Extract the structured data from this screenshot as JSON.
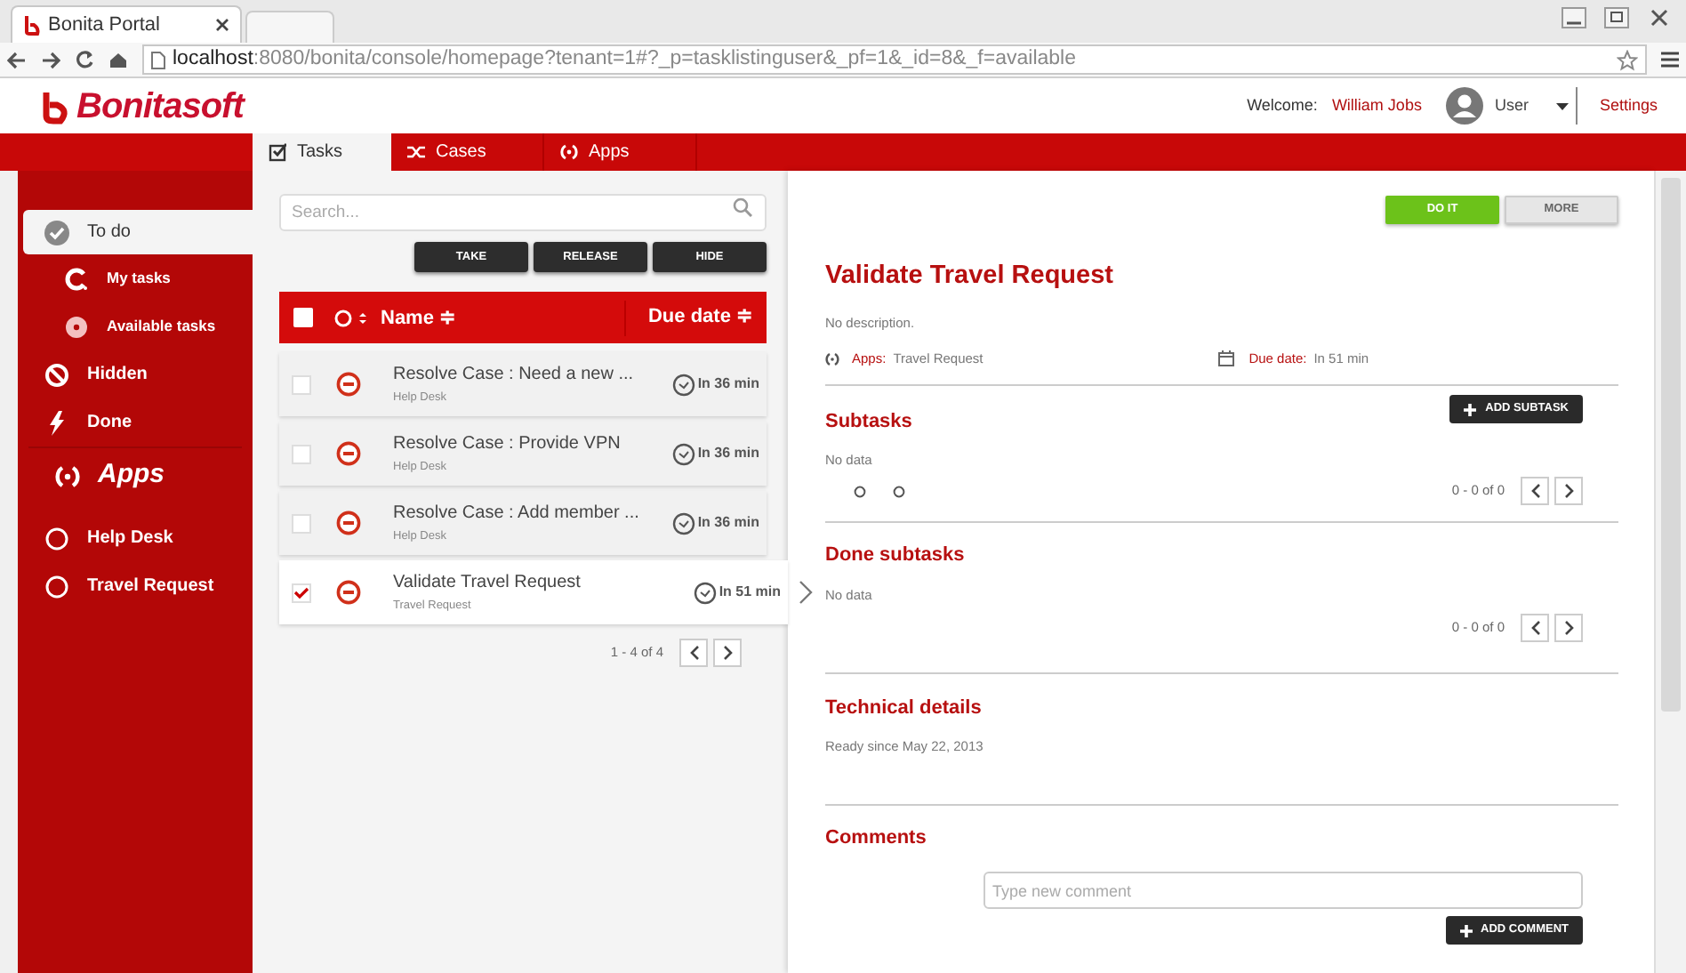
{
  "browser": {
    "tab_title": "Bonita Portal",
    "url_host": "localhost",
    "url_path": ":8080/bonita/console/homepage?tenant=1#?_p=tasklistinguser&_pf=1&_id=8&_f=available"
  },
  "header": {
    "logo": "Bonitasoft",
    "welcome": "Welcome:",
    "user_name": "William Jobs",
    "user_menu": "User",
    "settings": "Settings"
  },
  "nav_tabs": [
    {
      "label": "Tasks",
      "kind": "tasks",
      "selected": true
    },
    {
      "label": "Cases",
      "kind": "cases",
      "selected": false
    },
    {
      "label": "Apps",
      "kind": "apps",
      "selected": false
    }
  ],
  "sidebar": {
    "items": [
      {
        "label": "To do",
        "kind": "todo",
        "selected": true
      },
      {
        "label": "My tasks",
        "kind": "mytasks",
        "selected": false
      },
      {
        "label": "Available tasks",
        "kind": "available",
        "selected": false
      },
      {
        "label": "Hidden",
        "kind": "hidden",
        "selected": false
      },
      {
        "label": "Done",
        "kind": "done",
        "selected": false
      },
      {
        "label": "Apps",
        "kind": "section",
        "selected": false
      },
      {
        "label": "Help Desk",
        "kind": "app",
        "selected": false
      },
      {
        "label": "Travel Request",
        "kind": "app",
        "selected": false
      }
    ]
  },
  "task_list": {
    "search": {
      "placeholder": "Search..."
    },
    "actions": [
      "TAKE",
      "RELEASE",
      "HIDE"
    ],
    "select_all": {
      "checked": false
    },
    "columns": [
      {
        "label": "Name ≑"
      },
      {
        "label": "Due date ≑"
      }
    ],
    "rows": [
      {
        "name": "Resolve Case : Need a new ...",
        "app": "Help Desk",
        "due": "In 36 min",
        "checked": false,
        "selected": false
      },
      {
        "name": "Resolve Case : Provide VPN",
        "app": "Help Desk",
        "due": "In 36 min",
        "checked": false,
        "selected": false
      },
      {
        "name": "Resolve Case : Add member ...",
        "app": "Help Desk",
        "due": "In 36 min",
        "checked": false,
        "selected": false
      },
      {
        "name": "Validate Travel Request",
        "app": "Travel Request",
        "due": "In 51 min",
        "checked": true,
        "selected": true
      }
    ],
    "pagination": "1 - 4 of 4"
  },
  "detail": {
    "buttons": [
      {
        "label": "DO IT",
        "kind": "primary"
      },
      {
        "label": "MORE",
        "kind": "secondary"
      }
    ],
    "title": "Validate Travel Request",
    "description": "No description.",
    "apps_label": "Apps:",
    "apps_value": "Travel Request",
    "due_label": "Due date:",
    "due_value": "In 51 min",
    "subtasks": {
      "title": "Subtasks",
      "add_button": "ADD SUBTASK",
      "empty": "No data",
      "pagination": "0 - 0 of 0"
    },
    "done_subtasks": {
      "title": "Done subtasks",
      "empty": "No data",
      "pagination": "0 - 0 of 0"
    },
    "technical": {
      "title": "Technical details",
      "text": "Ready since May 22, 2013"
    },
    "comments": {
      "title": "Comments",
      "placeholder": "Type new comment",
      "add_button": "ADD COMMENT"
    }
  }
}
